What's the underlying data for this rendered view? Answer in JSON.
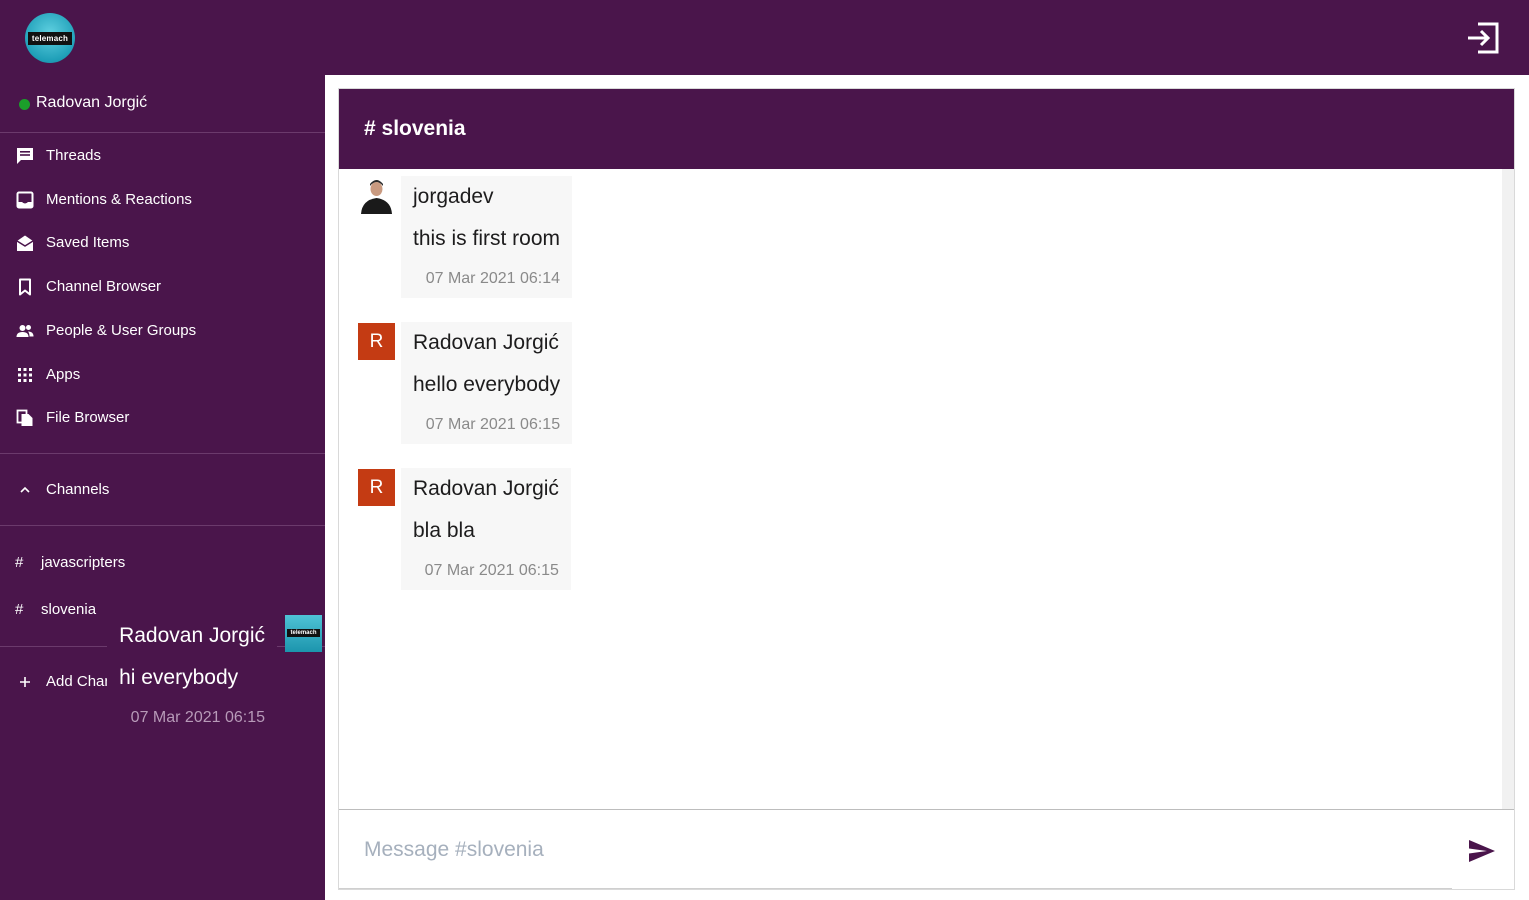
{
  "app": {
    "logo_text": "telemach"
  },
  "colors": {
    "brand": "#4a154b",
    "status_online": "#1b9e2a",
    "avatar_letter_bg": "#c43b13"
  },
  "user": {
    "name": "Radovan Jorgić",
    "status": "online"
  },
  "nav": {
    "items": [
      {
        "label": "Threads",
        "icon": "threads-icon"
      },
      {
        "label": "Mentions & Reactions",
        "icon": "inbox-icon"
      },
      {
        "label": "Saved Items",
        "icon": "open-envelope-icon"
      },
      {
        "label": "Channel Browser",
        "icon": "bookmark-icon"
      },
      {
        "label": "People & User Groups",
        "icon": "people-icon"
      },
      {
        "label": "Apps",
        "icon": "apps-grid-icon"
      },
      {
        "label": "File Browser",
        "icon": "files-icon"
      }
    ]
  },
  "channels_section": {
    "label": "Channels",
    "channels": [
      {
        "label": "javascripters"
      },
      {
        "label": "slovenia"
      }
    ],
    "add_label": "Add Channel"
  },
  "channel": {
    "title": "# slovenia"
  },
  "messages": [
    {
      "author": "jorgadev",
      "text": "this is first room",
      "time": "07 Mar 2021 06:14",
      "avatar": "photo"
    },
    {
      "author": "Radovan Jorgić",
      "text": "hello everybody",
      "time": "07 Mar 2021 06:15",
      "avatar": "R"
    },
    {
      "author": "Radovan Jorgić",
      "text": "bla bla",
      "time": "07 Mar 2021 06:15",
      "avatar": "R"
    },
    {
      "author": "Radovan Jorgić",
      "text": "hi everybody",
      "time": "07 Mar 2021 06:15",
      "avatar": "logo",
      "own": true
    }
  ],
  "composer": {
    "placeholder": "Message #slovenia",
    "value": ""
  }
}
